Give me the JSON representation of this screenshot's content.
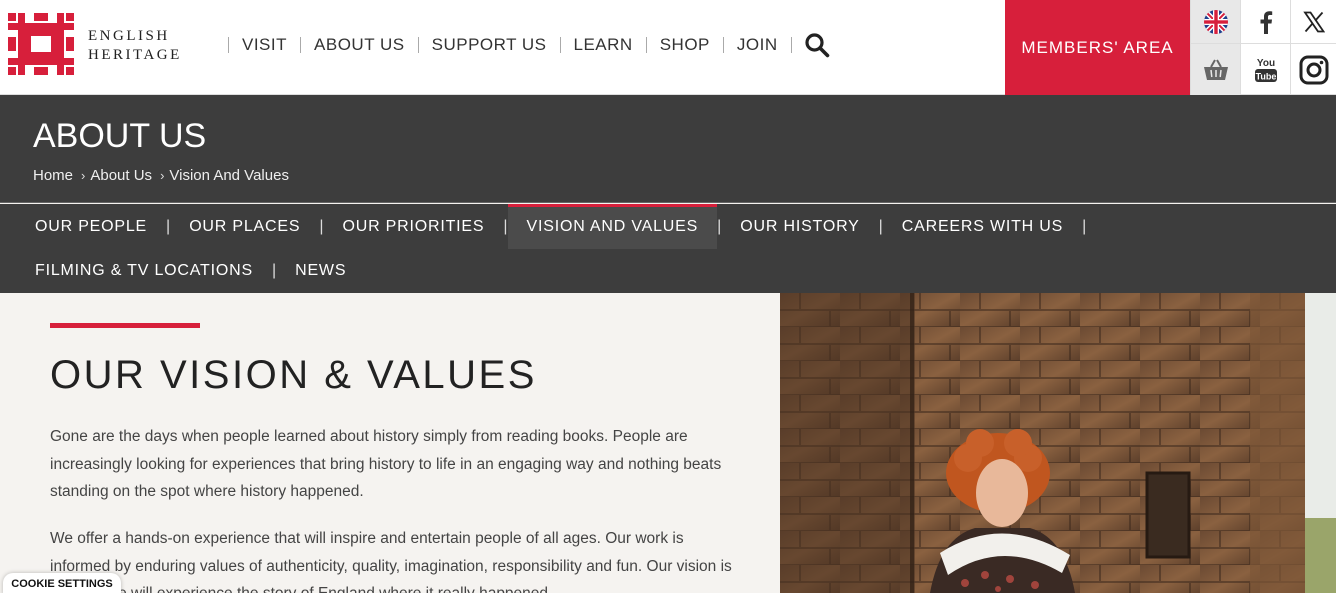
{
  "brand": {
    "line1": "ENGLISH",
    "line2": "HERITAGE",
    "logo_color": "#d71f3b"
  },
  "mainnav": {
    "items": [
      "VISIT",
      "ABOUT US",
      "SUPPORT US",
      "LEARN",
      "SHOP",
      "JOIN"
    ],
    "search_icon": "search-icon"
  },
  "members": {
    "label": "MEMBERS' AREA",
    "color": "#d71f3b"
  },
  "social": {
    "icons": [
      "uk-flag-icon",
      "facebook-icon",
      "x-icon",
      "basket-icon",
      "youtube-icon",
      "instagram-icon"
    ],
    "youtube_text_1": "You",
    "youtube_text_2": "Tube"
  },
  "banner": {
    "title": "ABOUT US",
    "breadcrumb": [
      "Home",
      "About Us",
      "Vision And Values"
    ]
  },
  "subnav": {
    "row1": [
      "OUR PEOPLE",
      "OUR PLACES",
      "OUR PRIORITIES",
      "VISION AND VALUES",
      "OUR HISTORY",
      "CAREERS WITH US"
    ],
    "row2": [
      "FILMING & TV LOCATIONS",
      "NEWS"
    ],
    "active": "VISION AND VALUES"
  },
  "content": {
    "heading": "OUR VISION & VALUES",
    "p1": "Gone are the days when people learned about history simply from reading books. People are increasingly looking for experiences that bring history to life in an engaging way and nothing beats standing on the spot where history happened.",
    "p2": "We offer a hands-on experience that will inspire and entertain people of all ages. Our work is informed by enduring values of authenticity, quality, imagination, responsibility and fun. Our vision is that people will experience the story of England where it really happened."
  },
  "cookie": {
    "label": "COOKIE SETTINGS"
  }
}
